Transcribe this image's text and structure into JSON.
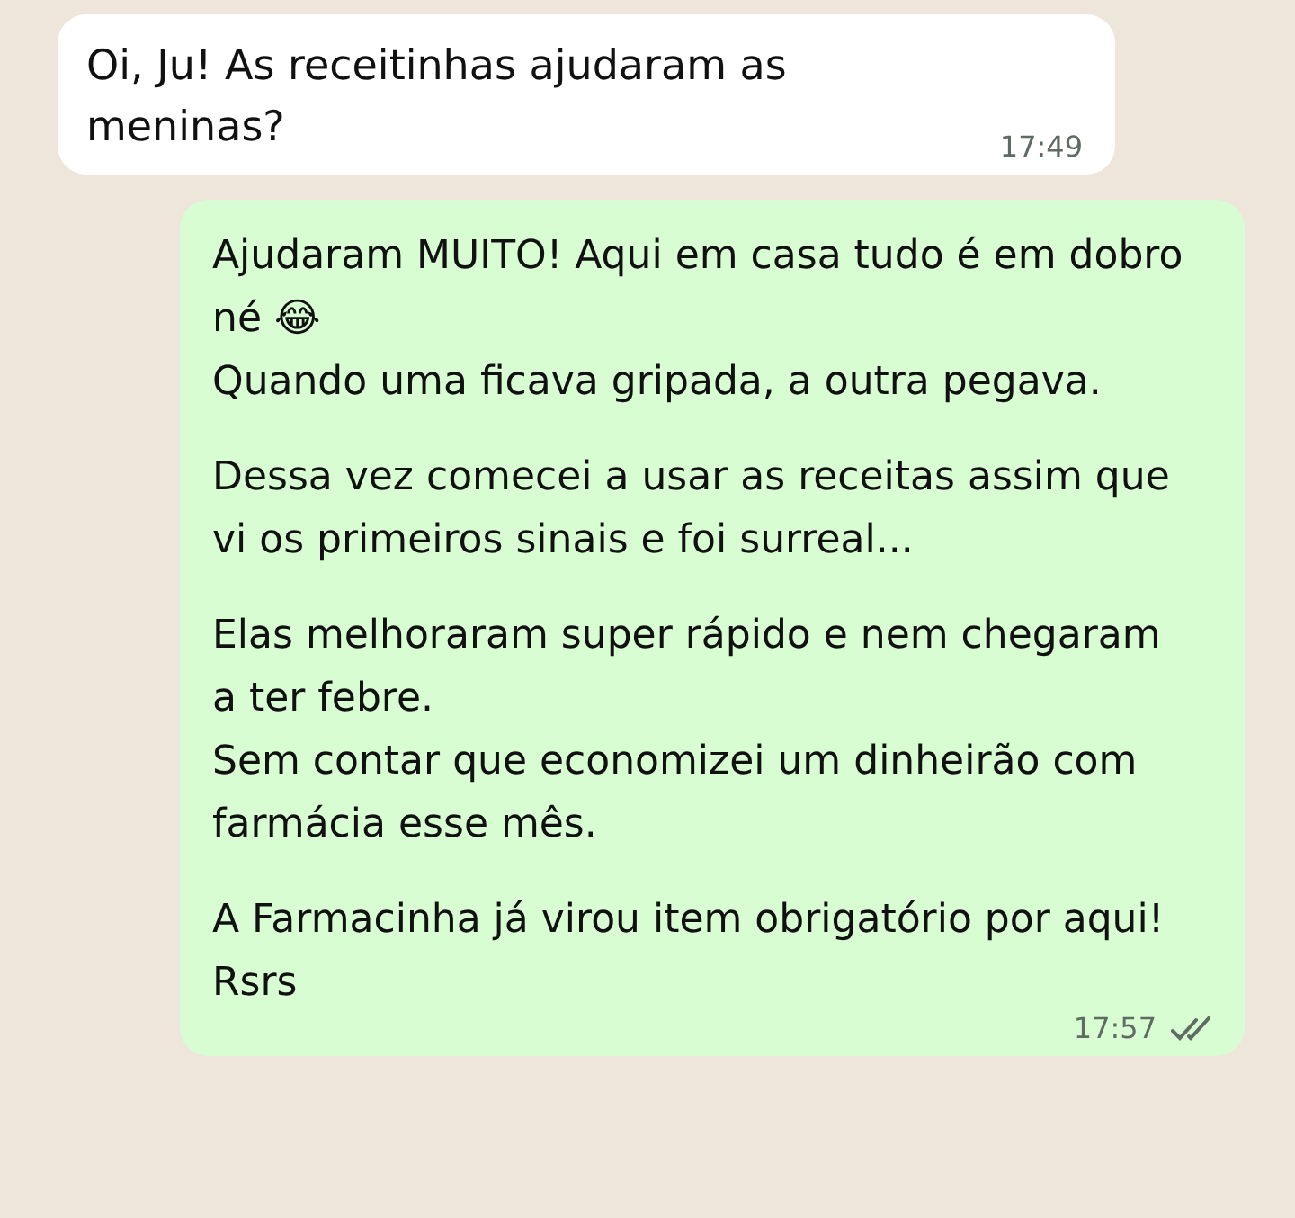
{
  "messages": [
    {
      "kind": "incoming",
      "blocks": [
        [
          "Oi, Ju! As receitinhas ajudaram as meninas?"
        ]
      ],
      "time": "17:49"
    },
    {
      "kind": "outgoing",
      "blocks": [
        [
          "Ajudaram MUITO! Aqui em casa tudo é em dobro né 😂",
          "Quando uma ficava gripada, a outra pegava."
        ],
        [
          "Dessa vez comecei a usar as receitas assim que vi os primeiros sinais e foi surreal..."
        ],
        [
          "Elas melhoraram super rápido e nem chegaram a ter febre.",
          "Sem contar que economizei um dinheirão com farmácia esse mês."
        ],
        [
          "A Farmacinha já virou item obrigatório por aqui! Rsrs"
        ]
      ],
      "time": "17:57",
      "read": false
    }
  ]
}
